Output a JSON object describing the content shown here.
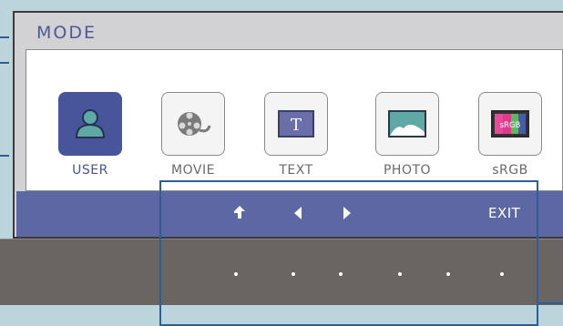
{
  "osd": {
    "title": "MODE",
    "modes": [
      {
        "label": "USER",
        "icon": "user-icon",
        "selected": true
      },
      {
        "label": "MOVIE",
        "icon": "film-reel-icon",
        "selected": false
      },
      {
        "label": "TEXT",
        "icon": "text-icon",
        "selected": false
      },
      {
        "label": "PHOTO",
        "icon": "photo-icon",
        "selected": false
      },
      {
        "label": "sRGB",
        "icon": "srgb-icon",
        "selected": false
      }
    ],
    "icon_text": {
      "text_glyph": "T",
      "srgb_glyph": "sRGB"
    },
    "nav": {
      "up_icon": "return-arrow-icon",
      "left_icon": "left-arrow-icon",
      "right_icon": "right-arrow-icon",
      "exit_label": "EXIT"
    }
  },
  "bezel": {
    "button_dots": 6
  },
  "colors": {
    "accent": "#48559a",
    "bottom_bar": "#5c67a4",
    "callout": "#2c5f96",
    "background": "#bcd4dc"
  }
}
